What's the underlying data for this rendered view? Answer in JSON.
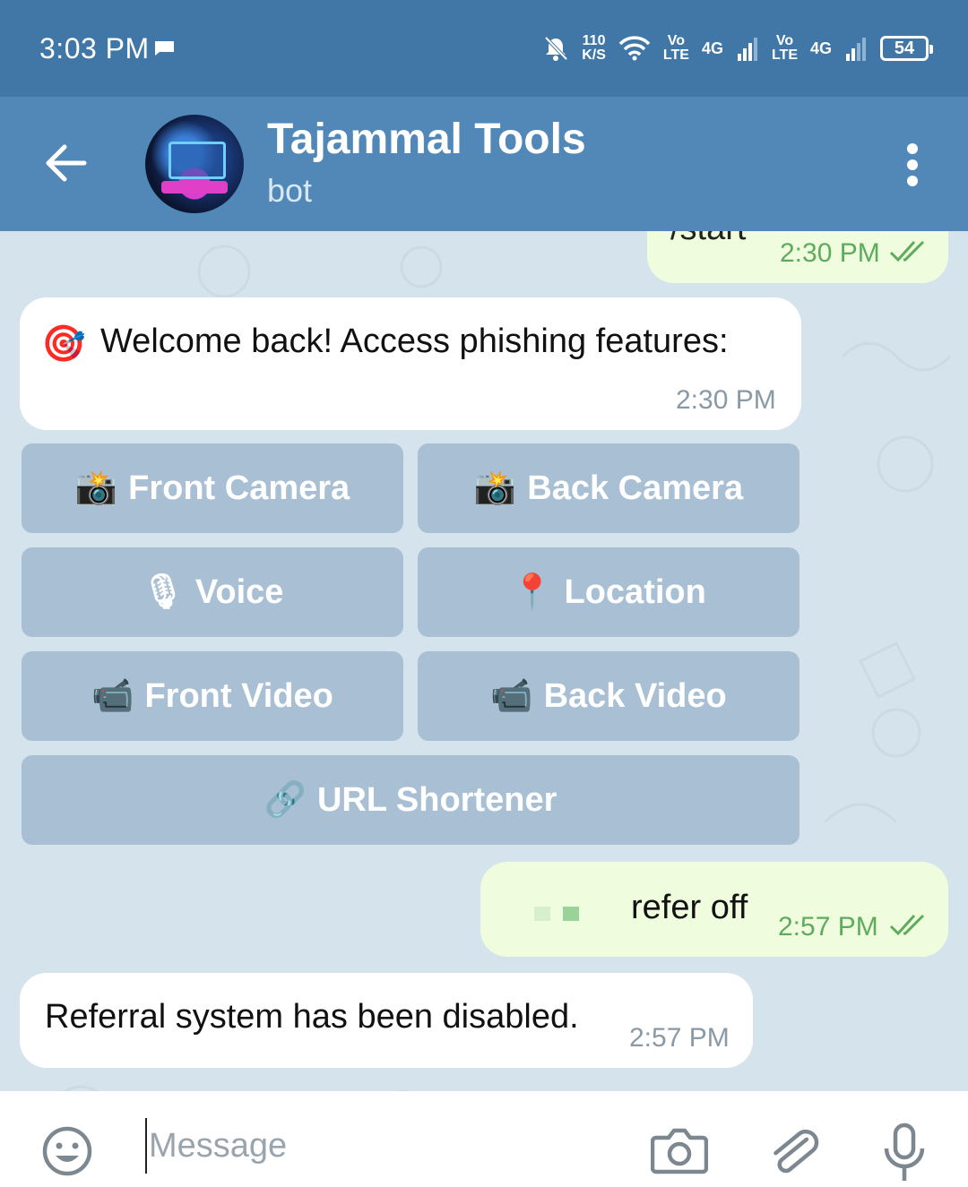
{
  "status_bar": {
    "time": "3:03 PM",
    "speed_value": "110",
    "speed_unit": "K/S",
    "sim1_vo": "Vo",
    "sim1_lte": "LTE",
    "sim1_net": "4G",
    "sim2_vo": "Vo",
    "sim2_lte": "LTE",
    "sim2_net": "4G",
    "battery": "54"
  },
  "header": {
    "title": "Tajammal Tools",
    "subtitle": "bot"
  },
  "messages": {
    "start_cmd": "/start",
    "start_time": "2:30 PM",
    "welcome_text": "Welcome back! Access phishing features:",
    "welcome_emoji": "🎯",
    "welcome_time": "2:30 PM",
    "refer_text": "refer off",
    "refer_time": "2:57 PM",
    "disabled_text": "Referral system has been disabled.",
    "disabled_time": "2:57 PM"
  },
  "keyboard": {
    "front_camera": "Front Camera",
    "back_camera": "Back Camera",
    "voice": "Voice",
    "location": "Location",
    "front_video": "Front Video",
    "back_video": "Back Video",
    "url_shortener": "URL Shortener",
    "camera_emoji": "📸",
    "voice_emoji": "🎙",
    "location_emoji": "📍",
    "video_emoji": "📹",
    "link_emoji": "🔗"
  },
  "input": {
    "placeholder": "Message"
  },
  "colors": {
    "status_bar": "#4177a6",
    "header": "#5288b8",
    "outgoing_bubble": "#effdde",
    "keyboard_button": "#a9c0d4",
    "chat_background": "#d5e3ec"
  }
}
